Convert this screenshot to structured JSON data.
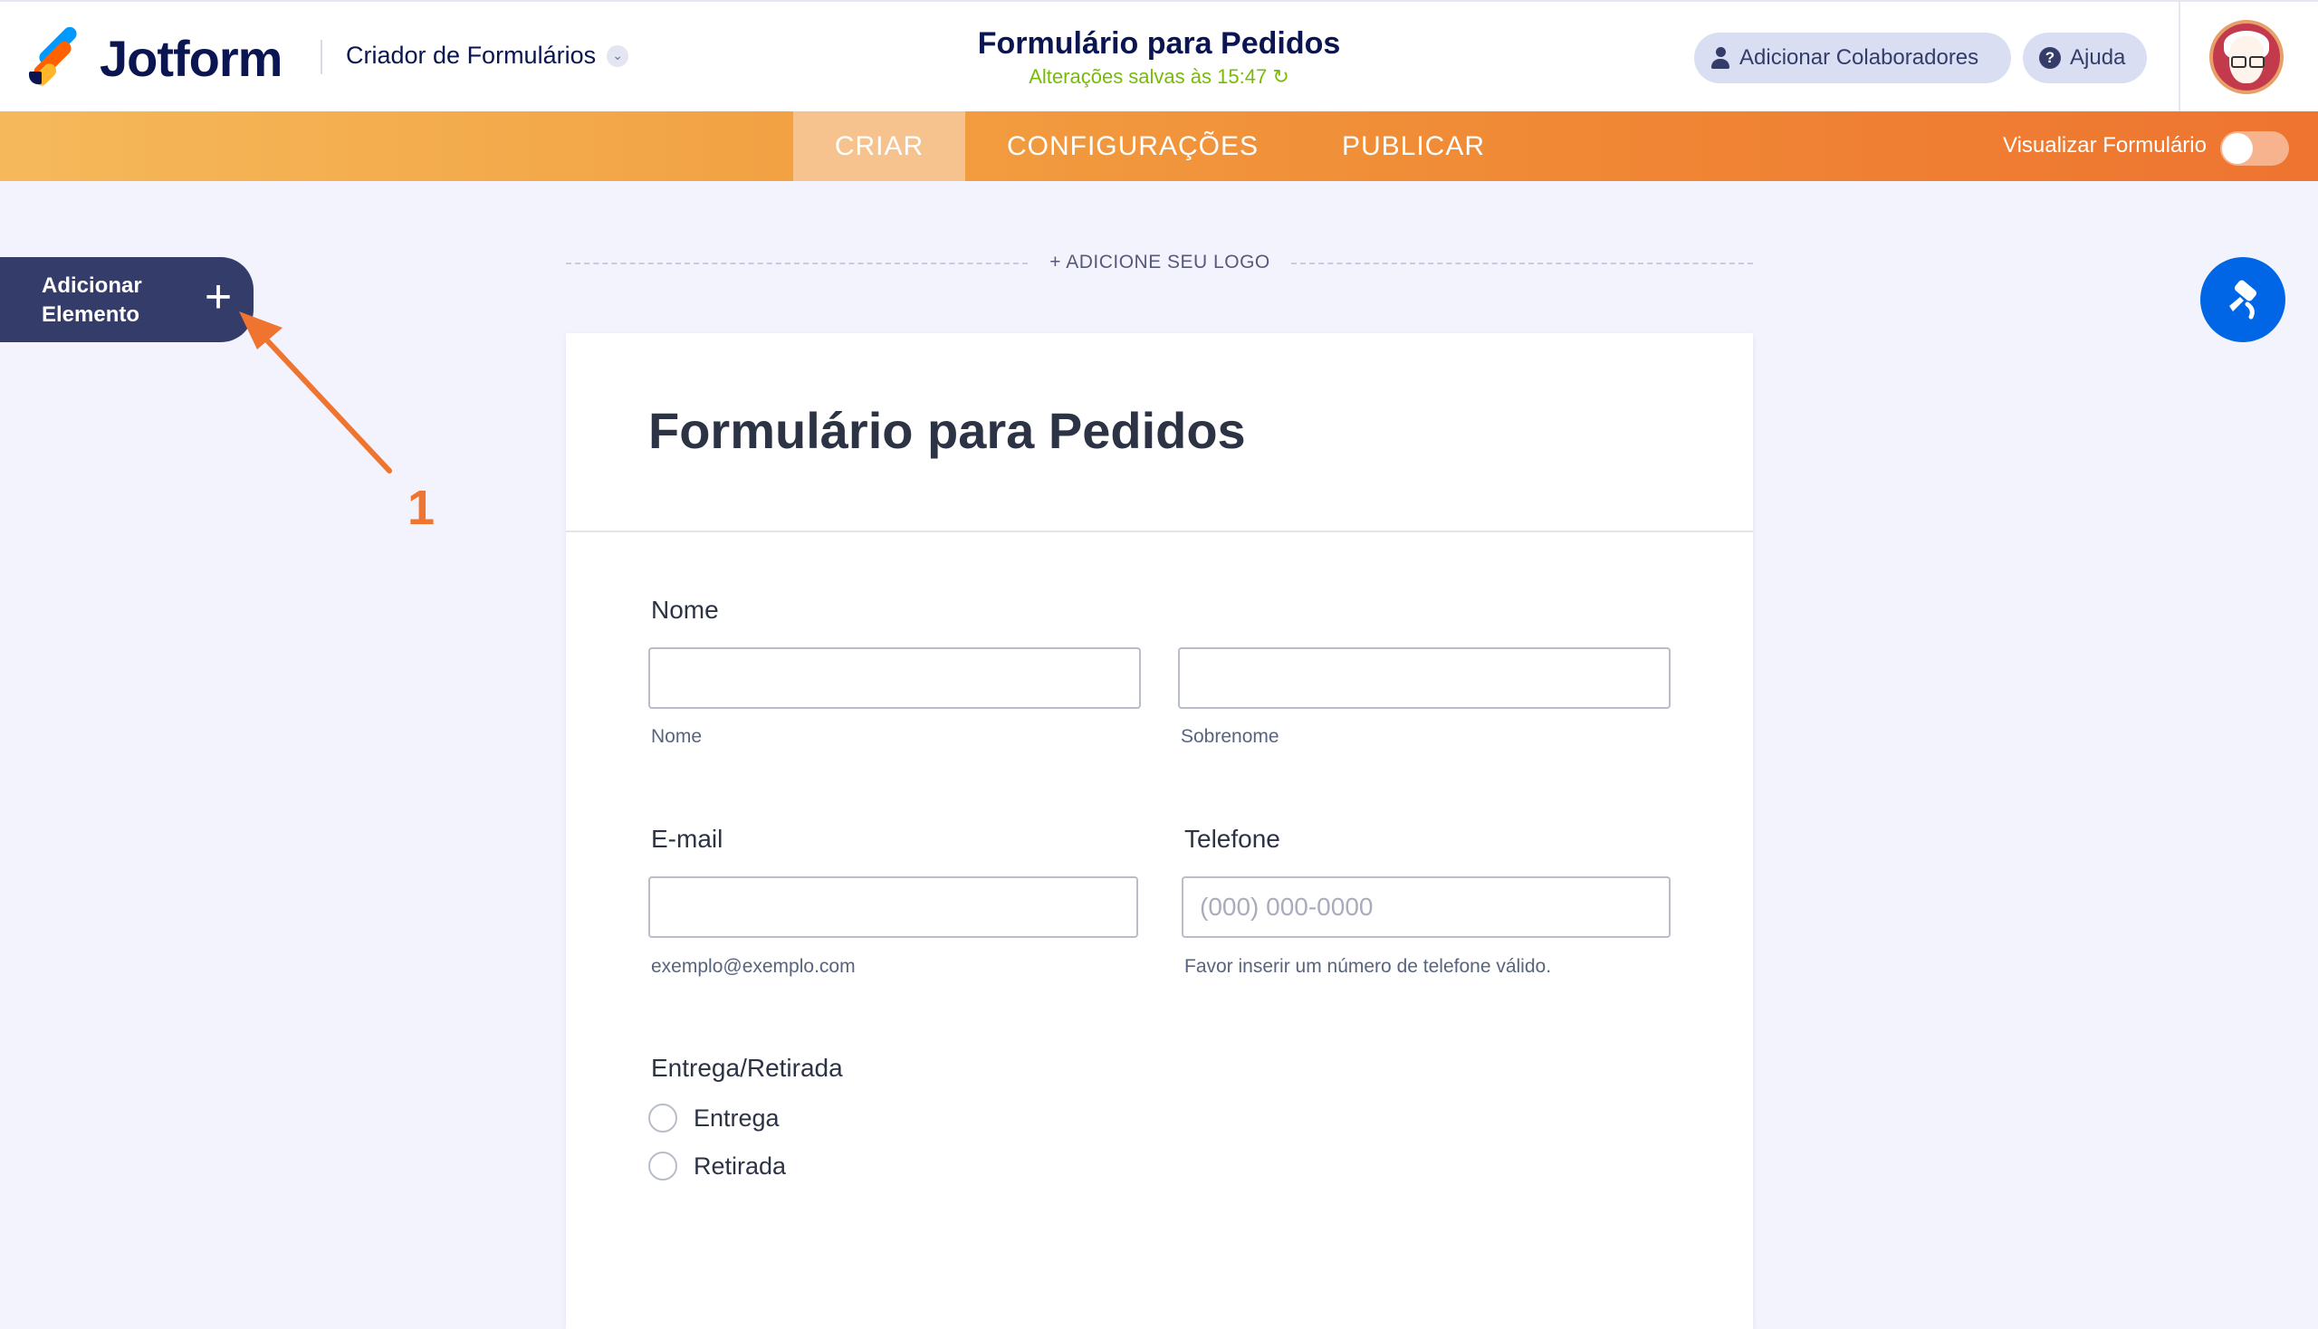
{
  "header": {
    "logo_text": "Jotform",
    "builder_title": "Criador de Formulários",
    "form_title": "Formulário para Pedidos",
    "saved_status": "Alterações salvas às 15:47",
    "collaborators_label": "Adicionar Colaboradores",
    "help_label": "Ajuda"
  },
  "nav": {
    "tabs": [
      {
        "label": "CRIAR",
        "active": true
      },
      {
        "label": "CONFIGURAÇÕES",
        "active": false
      },
      {
        "label": "PUBLICAR",
        "active": false
      }
    ],
    "preview_label": "Visualizar Formulário",
    "preview_on": false
  },
  "sidebar": {
    "add_element_label": "Adicionar Elemento"
  },
  "annotation": {
    "number": "1",
    "color": "#ee7430"
  },
  "form": {
    "add_logo_label": "+ ADICIONE SEU LOGO",
    "title": "Formulário para Pedidos",
    "fields": {
      "name_label": "Nome",
      "first_name_sublabel": "Nome",
      "last_name_sublabel": "Sobrenome",
      "email_label": "E-mail",
      "email_sublabel": "exemplo@exemplo.com",
      "phone_label": "Telefone",
      "phone_placeholder": "(000) 000-0000",
      "phone_sublabel": "Favor inserir um número de telefone válido.",
      "delivery_label": "Entrega/Retirada",
      "delivery_options": [
        "Entrega",
        "Retirada"
      ]
    }
  },
  "colors": {
    "brand_navy": "#0a1551",
    "accent_orange": "#ee7430",
    "saved_green": "#78bb07",
    "fab_blue": "#0066e6"
  }
}
